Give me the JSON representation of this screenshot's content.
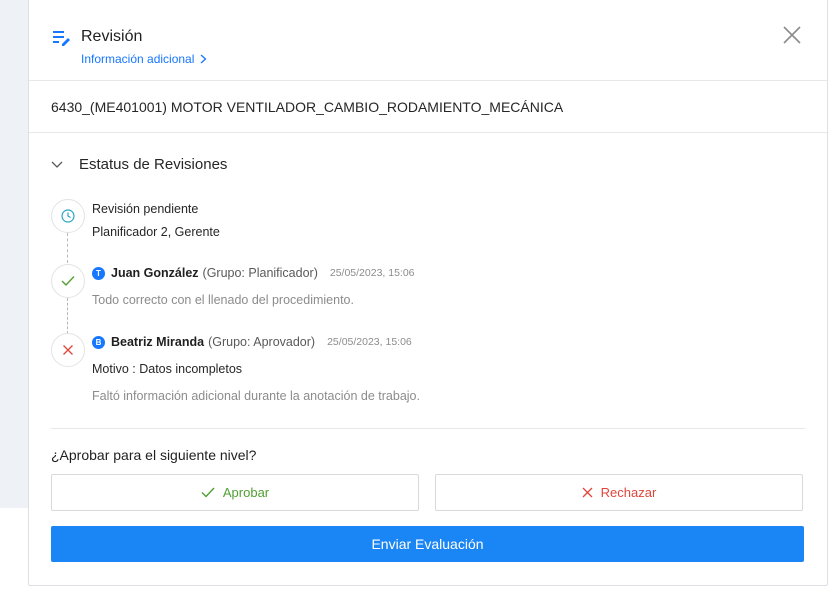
{
  "header": {
    "title": "Revisión",
    "info_link": "Información adicional"
  },
  "task": {
    "name": "6430_(ME401001) MOTOR VENTILADOR_CAMBIO_RODAMIENTO_MECÁNICA"
  },
  "status": {
    "section_title": "Estatus de Revisiones",
    "pending": {
      "title": "Revisión pendiente",
      "assignees": "Planificador 2, Gerente",
      "icon": "clock-icon",
      "color": "#29a3c7"
    },
    "entries": [
      {
        "badge": "T",
        "name": "Juan González",
        "group": "(Grupo: Planificador)",
        "date": "25/05/2023, 15:06",
        "comment": "Todo correcto con el llenado del procedimiento.",
        "icon": "check-icon",
        "color": "#52a033"
      },
      {
        "badge": "B",
        "name": "Beatriz Miranda",
        "group": "(Grupo: Aprovador)",
        "date": "25/05/2023, 15:06",
        "reason": "Motivo : Datos incompletos",
        "comment": "Faltó información adicional durante la anotación de trabajo.",
        "icon": "x-icon",
        "color": "#e0463a"
      }
    ]
  },
  "decision": {
    "question": "¿Aprobar para el siguiente nivel?",
    "approve_label": "Aprobar",
    "reject_label": "Rechazar",
    "submit_label": "Enviar Evaluación"
  },
  "colors": {
    "primary": "#1a86f5",
    "link": "#1677ff",
    "approve": "#52a033",
    "reject": "#e0463a"
  }
}
